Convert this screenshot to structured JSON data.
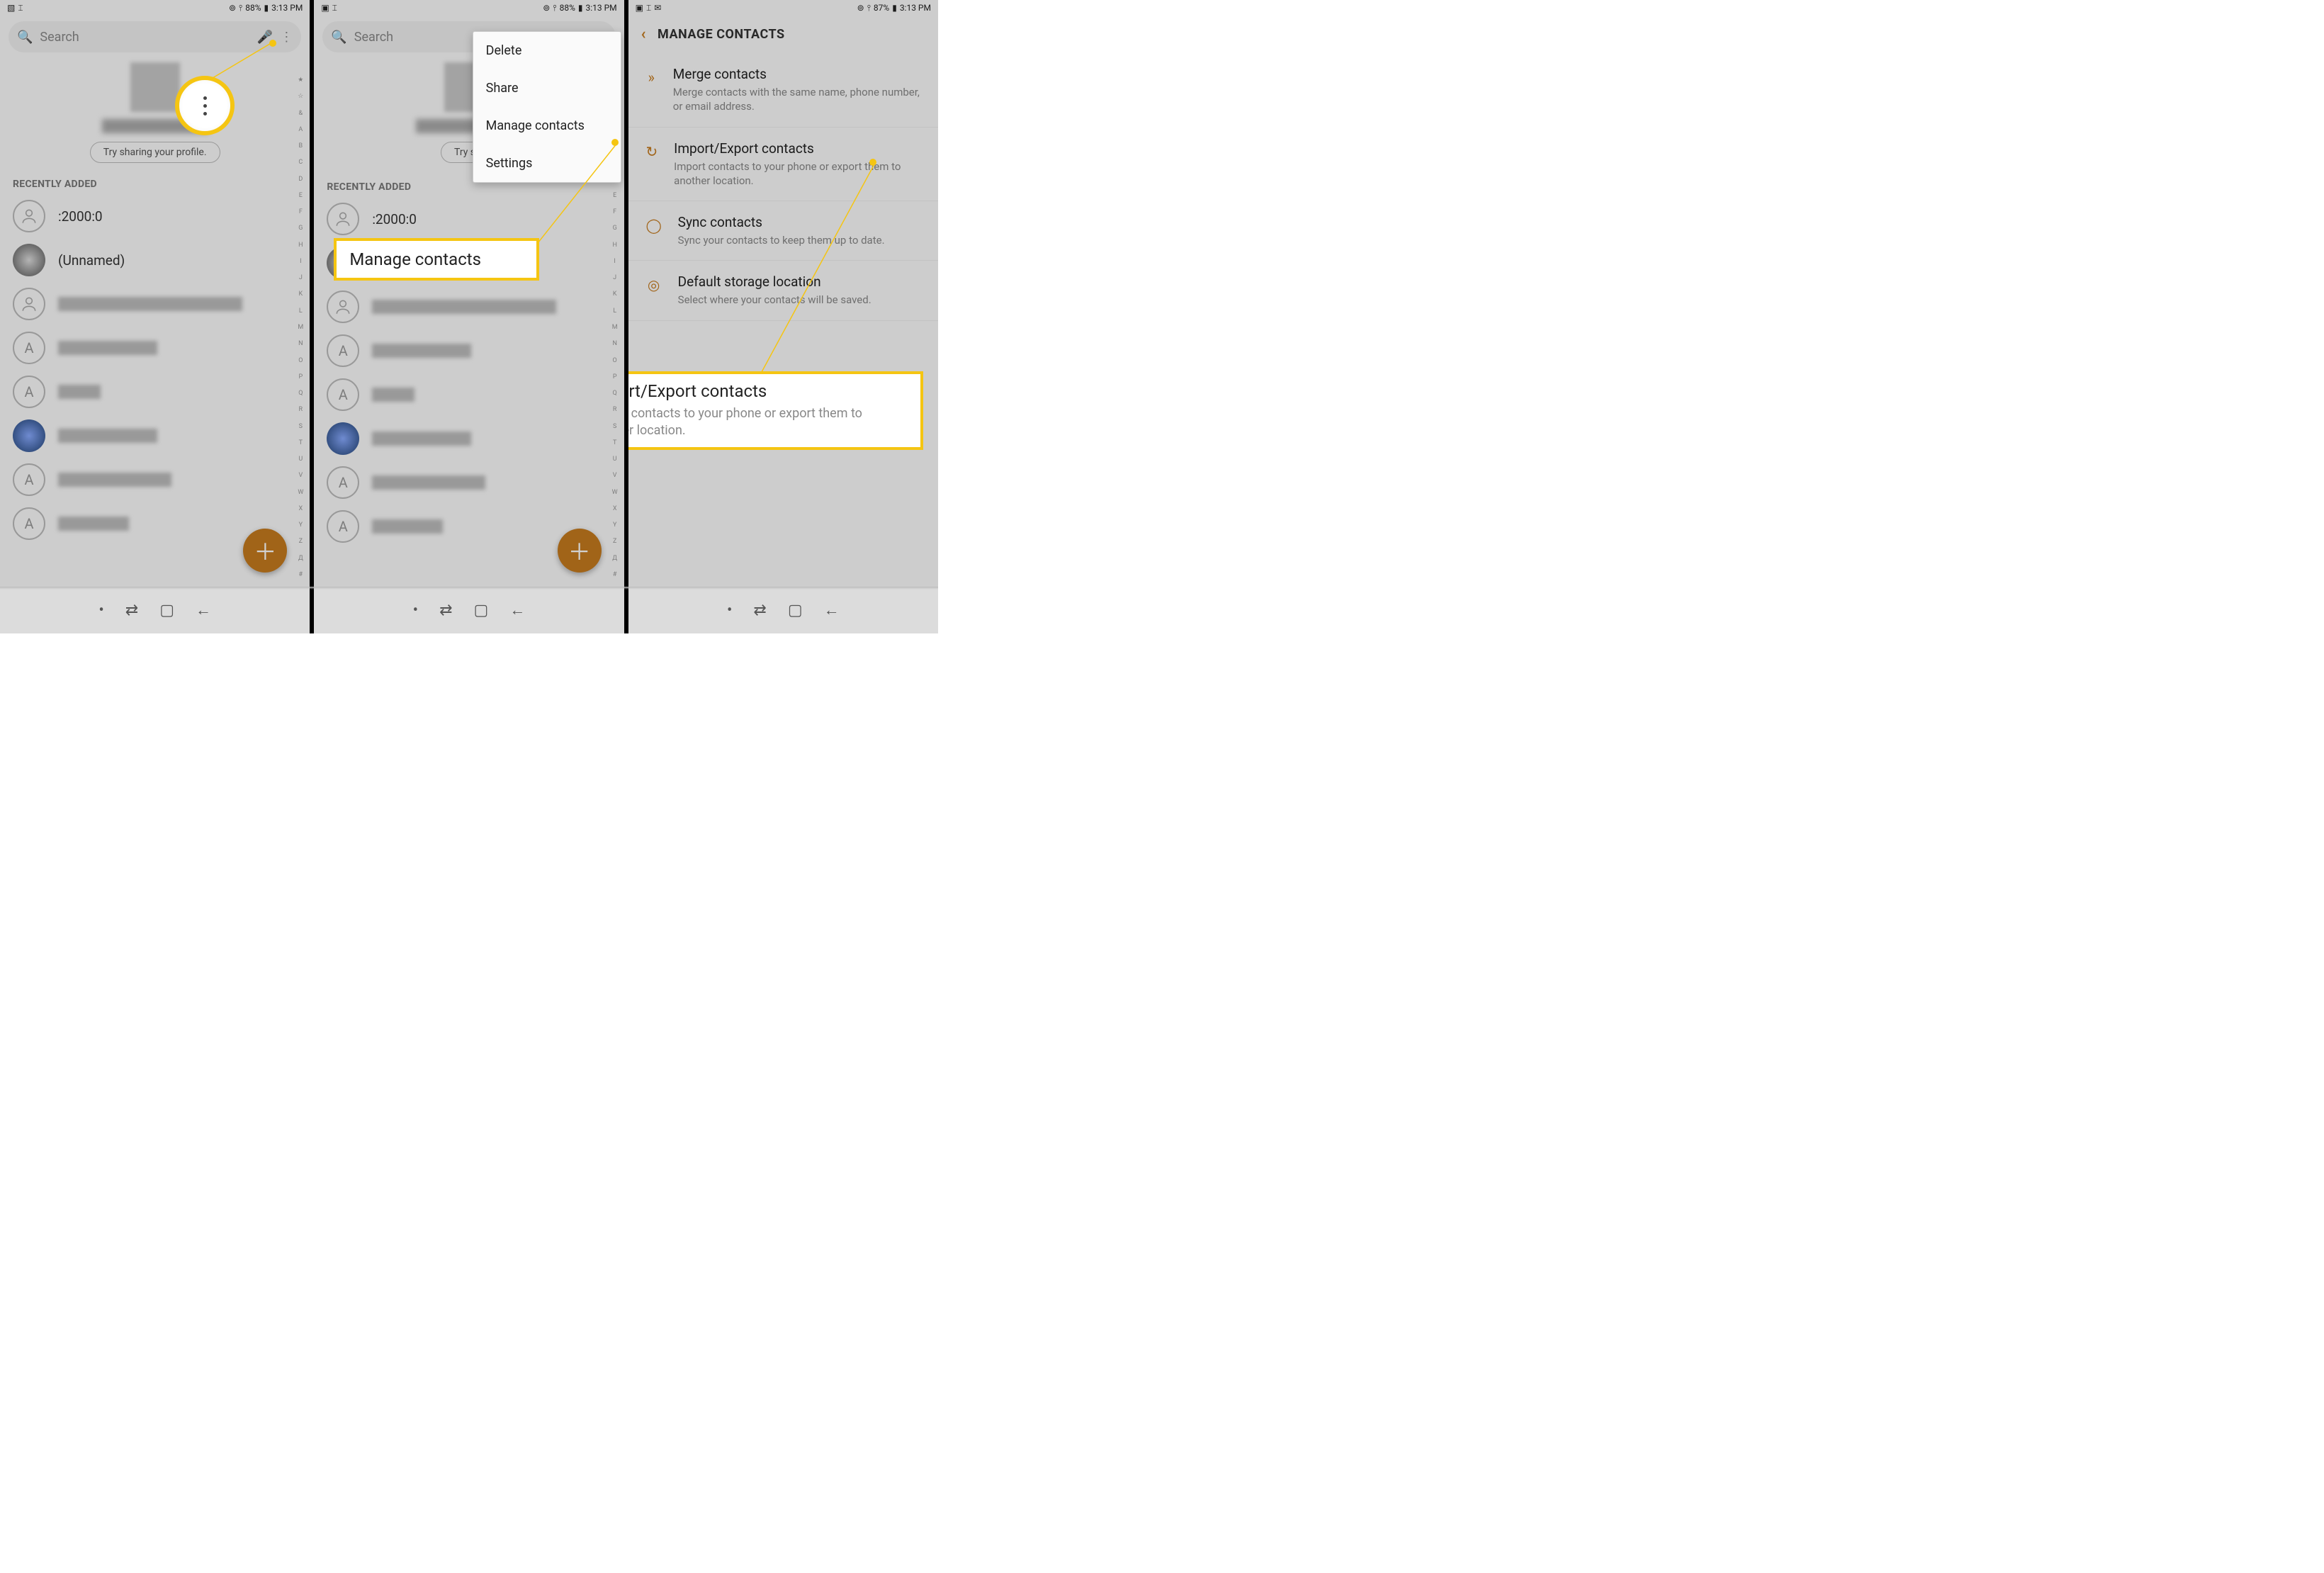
{
  "status": {
    "time": "3:13 PM",
    "battery1": "88%",
    "battery2": "88%",
    "battery3": "87%"
  },
  "search": {
    "placeholder": "Search"
  },
  "profile": {
    "try_sharing": "Try sharing your profile."
  },
  "sections": {
    "recently_added": "RECENTLY ADDED"
  },
  "contacts": [
    {
      "label": ":2000:0",
      "type": "outline"
    },
    {
      "label": "(Unnamed)",
      "type": "img"
    },
    {
      "label": "",
      "type": "outline",
      "redact": 260
    },
    {
      "label": "",
      "type": "letter",
      "letter": "A",
      "redact": 140
    },
    {
      "label": "",
      "type": "letter",
      "letter": "A",
      "redact": 60
    },
    {
      "label": "",
      "type": "img2",
      "redact": 140
    },
    {
      "label": "",
      "type": "letter",
      "letter": "A",
      "redact": 160
    },
    {
      "label": "",
      "type": "letter",
      "letter": "A",
      "redact": 100
    }
  ],
  "index": "★☆&ABCDEFGHIJKLMNOPQRSTUVWXYZД#",
  "menu": [
    "Delete",
    "Share",
    "Manage contacts",
    "Settings"
  ],
  "manage": {
    "title": "MANAGE CONTACTS",
    "items": [
      {
        "t": "Merge contacts",
        "d": "Merge contacts with the same name, phone number, or email address.",
        "ic": "»"
      },
      {
        "t": "Import/Export contacts",
        "d": "Import contacts to your phone or export them to another location.",
        "ic": "↻"
      },
      {
        "t": "Sync contacts",
        "d": "Sync your contacts to keep them up to date.",
        "ic": "◯"
      },
      {
        "t": "Default storage location",
        "d": "Select where your contacts will be saved.",
        "ic": "◎"
      }
    ]
  },
  "callouts": {
    "c2": "Manage contacts",
    "c3t": "Import/Export contacts",
    "c3d": "Import contacts to your phone or export them to another location."
  }
}
